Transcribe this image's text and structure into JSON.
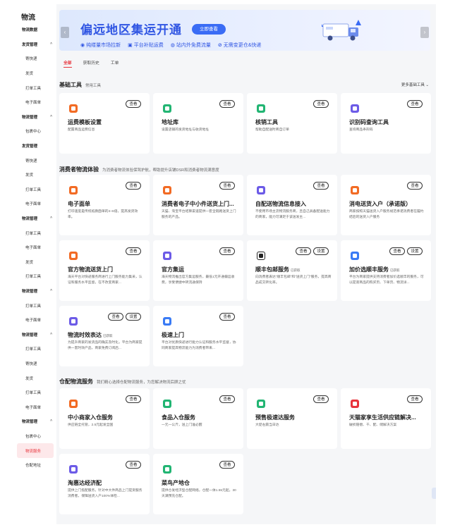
{
  "sidebar": {
    "title": "物流",
    "items": [
      {
        "label": "物流数据",
        "kind": "group"
      },
      {
        "label": "发货管理",
        "kind": "group",
        "chevron": "^"
      },
      {
        "label": "寄快递",
        "kind": "item"
      },
      {
        "label": "发货",
        "kind": "item"
      },
      {
        "label": "打单工具",
        "kind": "item"
      },
      {
        "label": "电子面单",
        "kind": "item"
      },
      {
        "label": "物流管理",
        "kind": "group",
        "chevron": "^"
      },
      {
        "label": "包裹中心",
        "kind": "item"
      },
      {
        "label": "发货管理",
        "kind": "group"
      },
      {
        "label": "寄快递",
        "kind": "item"
      },
      {
        "label": "发货",
        "kind": "item"
      },
      {
        "label": "打单工具",
        "kind": "item"
      },
      {
        "label": "电子面单",
        "kind": "item"
      },
      {
        "label": "物流管理",
        "kind": "group",
        "chevron": "^"
      },
      {
        "label": "打单工具",
        "kind": "item"
      },
      {
        "label": "电子面单",
        "kind": "item"
      },
      {
        "label": "发货",
        "kind": "item"
      },
      {
        "label": "打单工具",
        "kind": "item"
      },
      {
        "label": "物流管理",
        "kind": "group",
        "chevron": "^"
      },
      {
        "label": "打单工具",
        "kind": "item"
      },
      {
        "label": "电子面单",
        "kind": "item"
      },
      {
        "label": "物流管理",
        "kind": "group",
        "chevron": "^"
      },
      {
        "label": "打单工具",
        "kind": "item"
      },
      {
        "label": "寄快递",
        "kind": "item"
      },
      {
        "label": "发货",
        "kind": "item"
      },
      {
        "label": "打单工具",
        "kind": "item"
      },
      {
        "label": "电子面单",
        "kind": "item"
      },
      {
        "label": "物流管理",
        "kind": "group",
        "chevron": "^"
      },
      {
        "label": "包裹中心",
        "kind": "item"
      },
      {
        "label": "物流服务",
        "kind": "item",
        "active": true
      },
      {
        "label": "仓配地址",
        "kind": "item"
      }
    ]
  },
  "banner": {
    "title": "偏远地区集运开通",
    "button": "立即查看",
    "features": [
      {
        "icon": "shield-check-icon",
        "label": "纯缕量市场拉新"
      },
      {
        "icon": "platform-icon",
        "label": "平台补贴运费"
      },
      {
        "icon": "globe-icon",
        "label": "站内外免费流量"
      },
      {
        "icon": "link-icon",
        "label": "无需变更仓&快递"
      }
    ],
    "prev_arrow": "‹",
    "next_arrow": "›"
  },
  "tabs": {
    "items": [
      "全部",
      "获取历史",
      "工单"
    ],
    "active_index": 0
  },
  "sections": {
    "basic": {
      "title": "基础工具",
      "subtitle": "常用工具",
      "more": "更多基础工具 ⌄"
    },
    "consumer": {
      "title": "消费者物流体验",
      "subtitle": "为消费者物流体验保驾护航，帮助提升店铺DSR和消费者物流满意度"
    },
    "warehouse": {
      "title": "仓配物流服务",
      "subtitle": "我们精心选择仓配物流服务，为您解决物流后顾之忧"
    }
  },
  "labels": {
    "view": "查看",
    "settings": "设置"
  },
  "colors": {
    "accent": "#e8343c",
    "banner_blue": "#2f55e3",
    "icon_orange": "#f26b24",
    "icon_green": "#22b573",
    "icon_purple": "#6c5be7",
    "icon_blue": "#3a7bf5"
  },
  "cards": {
    "basic": [
      {
        "title": "运费模板设置",
        "desc": "配置商品运费信息",
        "icon": "template-icon",
        "color": "#f26b24",
        "buttons": [
          "view"
        ]
      },
      {
        "title": "地址库",
        "desc": "设置店铺的发货地址与收货地址",
        "icon": "location-icon",
        "color": "#22b573",
        "buttons": [
          "view"
        ]
      },
      {
        "title": "核销工具",
        "desc": "帮助自配送时商自订单",
        "icon": "verify-icon",
        "color": "#22b573",
        "buttons": [
          "view"
        ]
      },
      {
        "title": "识别码查询工具",
        "desc": "查询商品条形码",
        "icon": "barcode-icon",
        "color": "#6c5be7",
        "buttons": [
          "view"
        ]
      }
    ],
    "consumer": [
      {
        "title": "电子面单",
        "tag": "",
        "desc": "打印速度是传统纸质面单的4~6倍，提高发货效率。",
        "icon": "waybill-icon",
        "color": "#f26b24",
        "buttons": [
          "view"
        ]
      },
      {
        "title": "消费者电子中小件送货上门...",
        "tag": "",
        "desc": "天猫、淘宝平台结算渠道提供一套全链路送货上门服务的产品。",
        "icon": "thumb-icon",
        "color": "#f26b24",
        "buttons": [
          "view"
        ]
      },
      {
        "title": "自配送物流信息接入",
        "tag": "",
        "desc": "不使用市场主流物流服务商，且自己具备配送能力的商家，能力可满足于该送发主...",
        "icon": "deliver-icon",
        "color": "#6c5be7",
        "buttons": [
          "view"
        ]
      },
      {
        "title": "消电送货入户（承诺版）",
        "tag": "",
        "desc": "商家按照天猫送货入户服务规范承诺消费者在履约结后的送货入户服务",
        "icon": "home-delivery-icon",
        "color": "#f26b24",
        "buttons": [
          "view"
        ]
      },
      {
        "title": "官方物流送货上门",
        "tag": "",
        "desc": "海天平台对快递服务商进行上门服务能力集采，认证和服务水平监督，在不改变商家...",
        "icon": "official-logistics-icon",
        "color": "#f26b24",
        "buttons": [
          "view"
        ]
      },
      {
        "title": "官方集运",
        "tag": "",
        "desc": "海天物流推出官方集运服务，最低1元开通偏运收费，享受便捷中转流通保持",
        "icon": "consolidate-icon",
        "color": "#6c5be7",
        "buttons": [
          "view"
        ]
      },
      {
        "title": "顺丰包邮服务",
        "tag": "已获取",
        "desc": "向消费者表达\"顺丰包邮\"和\"送货上门\"服务，提高商品成交转化率。",
        "icon": "sf-icon",
        "color": "#ffffff",
        "buttons": [
          "view",
          "settings"
        ]
      },
      {
        "title": "加价选顺丰服务",
        "tag": "已获取",
        "desc": "平台为商家提供支持消费者加价选顺丰的服务，可以提高商品的购买页、下单页、物流详...",
        "icon": "sf-upgrade-icon",
        "color": "#3a7bf5",
        "buttons": [
          "view",
          "settings"
        ]
      },
      {
        "title": "物流时效表达",
        "tag": "已获取",
        "desc": "为提升商家的发货品的确实及时化，平台为商家提供一套时效产品，商家免费订阅后...",
        "icon": "timer-icon",
        "color": "#6c5be7",
        "buttons": [
          "view",
          "settings"
        ]
      },
      {
        "title": "极速上门",
        "tag": "",
        "desc": "平台对优质快递进行能力认证和服务水平监督，协同商家提高物流能力为消费者带来...",
        "icon": "fast-delivery-icon",
        "color": "#3a7bf5",
        "buttons": [
          "view"
        ]
      }
    ],
    "warehouse": [
      {
        "title": "中小商家入仓服务",
        "desc": "供应链全托管，2.5元起发全国",
        "icon": "warehouse-icon",
        "color": "#f26b24",
        "buttons": [
          "view"
        ]
      },
      {
        "title": "食品入仓服务",
        "desc": "一元一公斤，送上门准必醒",
        "icon": "food-icon",
        "color": "#22b573",
        "buttons": [
          "view"
        ]
      },
      {
        "title": "预售极速达服务",
        "desc": "大促右震当日达",
        "icon": "presale-icon",
        "color": "#22b573",
        "buttons": [
          "view"
        ]
      },
      {
        "title": "天猫家享生活供应链解决...",
        "desc": "破损赔偿、干、配、储解决方案",
        "icon": "supply-chain-icon",
        "color": "#e8343c",
        "buttons": [
          "view"
        ]
      },
      {
        "title": "淘惠达经济配",
        "desc": "提供上门揽配服务，针对中大件商品上门提货服务消费者，保障送货入户100%体检...",
        "icon": "economy-icon",
        "color": "#6c5be7",
        "buttons": [
          "view"
        ]
      },
      {
        "title": "菜鸟产地仓",
        "desc": "提供仓发经济型仓配网络，仓配一体1.55元起，30天满预充仓配。",
        "icon": "origin-warehouse-icon",
        "color": "#22b573",
        "buttons": [
          "view"
        ]
      }
    ]
  }
}
